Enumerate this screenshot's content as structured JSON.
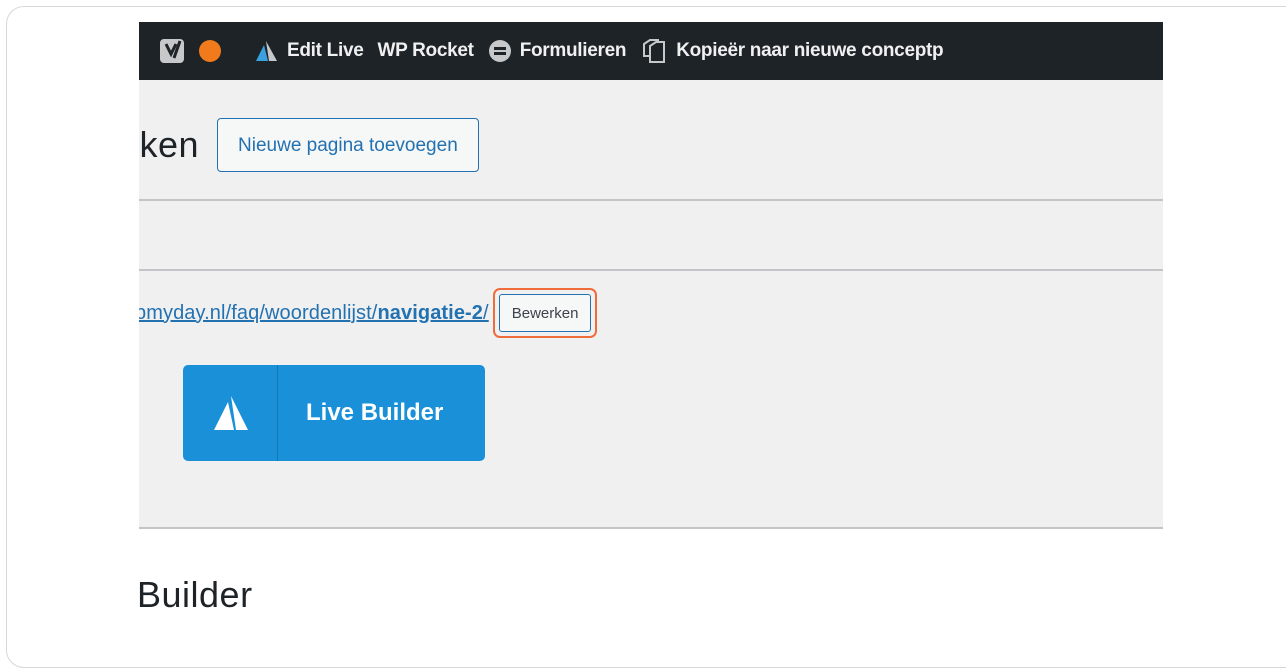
{
  "adminbar": {
    "items": [
      {
        "label": "Edit Live",
        "icon": "avada-icon"
      },
      {
        "label": "WP Rocket",
        "icon": ""
      },
      {
        "label": "Formulieren",
        "icon": "forms-icon"
      },
      {
        "label": "Kopieër naar nieuwe conceptp",
        "icon": "copy-icon"
      }
    ],
    "status_color": "#f07a1c"
  },
  "header": {
    "title_fragment": "rken",
    "add_button": "Nieuwe pagina toevoegen"
  },
  "permalink": {
    "url_base": "bmyday.nl/faq/woordenlijst/",
    "url_slug": "navigatie-2",
    "url_end": "/",
    "edit_button": "Bewerken"
  },
  "builder": {
    "button_label": "Live Builder",
    "accent_color": "#1a90d9"
  },
  "section": {
    "title_fragment": "Builder"
  }
}
